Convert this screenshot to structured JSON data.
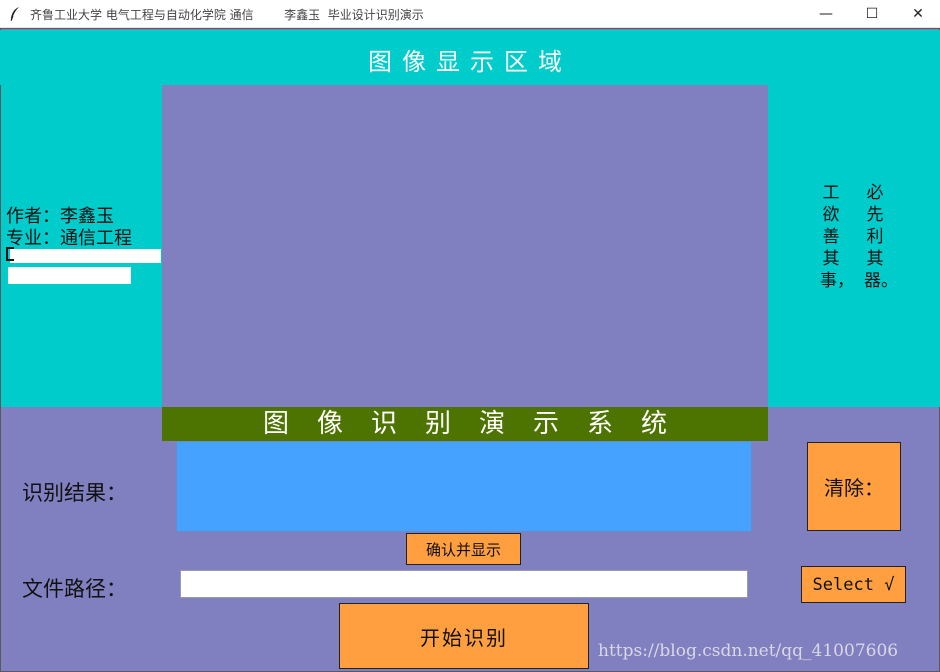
{
  "window": {
    "title": "齐鲁工业大学 电气工程与自动化学院 通信        李鑫玉  毕业设计识别演示",
    "icon": "feather-icon",
    "controls": {
      "minimize": "—",
      "maximize": "☐",
      "close": "✕"
    }
  },
  "header": {
    "title": "图像显示区域"
  },
  "author_panel": {
    "lines": [
      "作者：李鑫玉",
      "专业：通信工程"
    ]
  },
  "motto": {
    "columns": [
      "工欲善其事，",
      "必先利其器。"
    ]
  },
  "banner": {
    "title": "图像识别演示系统"
  },
  "result": {
    "label": "识别结果：",
    "value": ""
  },
  "buttons": {
    "clear": "清除：",
    "confirm": "确认并显示",
    "select": "Select √",
    "start": "开始识别"
  },
  "path": {
    "label": "文件路径：",
    "value": ""
  },
  "watermark": "https://blog.csdn.net/qq_41007606",
  "colors": {
    "cyan": "#00cccc",
    "lavender": "#8080c0",
    "banner_green": "#4d7300",
    "result_blue": "#45a2ff",
    "button_orange": "#ff9f40"
  }
}
